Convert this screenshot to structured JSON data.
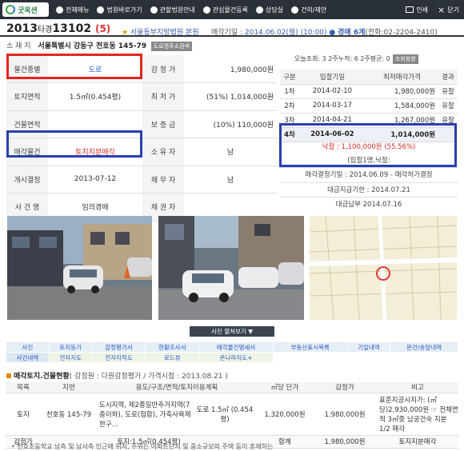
{
  "topbar": {
    "logo": "굿옥션",
    "menu": [
      "전체메뉴",
      "법원바로가기",
      "관할법원안내",
      "관심물건등록",
      "상담실",
      "건의/제안"
    ],
    "right": [
      "인쇄",
      "닫기"
    ]
  },
  "case": {
    "year": "2013",
    "type": "타경",
    "number": "13102",
    "count": "(5)",
    "court": "서울동부지방법원 본원",
    "sale_label": "매각기일 : ",
    "sale_date": "2014.06.02(월) (10:00)",
    "sale_dept": "경매 6계",
    "sale_phone": "(전화:02-2204-2410)"
  },
  "address": {
    "label": "소 재 지",
    "value": "서울특별시 강동구 천호동 145-79",
    "badge": "도로명주소검색"
  },
  "views": {
    "text": "오늘조회: 3 2주누적: 6 2주평균: 0",
    "button": "조회동향"
  },
  "info_rows": [
    {
      "h1": "물건종별",
      "v1": "도로",
      "h2": "감 정 가",
      "v2": "1,980,000원"
    },
    {
      "h1": "토지면적",
      "v1": "1.5㎡(0.454평)",
      "h2": "최 저 가",
      "v2": "(51%) 1,014,000원"
    },
    {
      "h1": "건물면적",
      "v1": "",
      "h2": "보 증 금",
      "v2": "(10%) 110,000원"
    },
    {
      "h1": "매각물건",
      "v1": "토지지분매각",
      "h2": "소 유 자",
      "v2": "남"
    },
    {
      "h1": "개시결정",
      "v1": "2013-07-12",
      "h2": "채 무 자",
      "v2": "남"
    },
    {
      "h1": "사 건 명",
      "v1": "임의경매",
      "h2": "채 권 자",
      "v2": ""
    }
  ],
  "bids": {
    "headers": [
      "구분",
      "입찰기일",
      "최저매각가격",
      "결과"
    ],
    "rows": [
      {
        "round": "1차",
        "date": "2014-02-10",
        "price": "1,980,000원",
        "result": "유찰"
      },
      {
        "round": "2차",
        "date": "2014-03-17",
        "price": "1,584,000원",
        "result": "유찰"
      },
      {
        "round": "3차",
        "date": "2014-04-21",
        "price": "1,267,000원",
        "result": "유찰"
      },
      {
        "round": "4차",
        "date": "2014-06-02",
        "price": "1,014,000원",
        "result": ""
      }
    ],
    "sold": "낙찰 : 1,100,000원 (55.56%)",
    "bidders": "(입찰1명,낙찰:",
    "post": [
      "매각결정기일 : 2014.06.09 - 매각허가결정",
      "대금지급기한 : 2014.07.21",
      "대금납부 2014.07.16"
    ]
  },
  "photo_button": "사진 펼쳐보기",
  "tabs_row1": [
    "사진",
    "토지등기",
    "감정평가서",
    "현황조사서",
    "매각물건명세서",
    "부동산표시목록",
    "기일내역",
    "문건/송달내역"
  ],
  "tabs_row2": [
    "사건내역",
    "전자지도",
    "전자지적도",
    "로드뷰",
    "온나라지도+"
  ],
  "land_section": {
    "title": "매각토지.건물현황",
    "sub": "( 감정원 : 다원감정평가 / 가격시점 : 2013.08.21 )"
  },
  "land_table": {
    "headers": [
      "목록",
      "지번",
      "용도/구조/면적/토지이용계획",
      "㎡당 단가",
      "감정가",
      "비고"
    ],
    "row": {
      "cat": "토지",
      "lot": "천호동 145-79",
      "use": "도시지역, 제2종일반주거지역(7층이하), 도로(접합), 가축사육제한구...",
      "area": "도로 1.5㎡ (0.454평)",
      "unit": "1,320,000원",
      "price": "1,980,000원",
      "note": "표준지공시지가: (㎡당)2,930,000원 ☞ 전체면적 3㎡중 남궁건숙 지분 1/2 매각"
    },
    "footer": {
      "label": "감정가",
      "area": "토지:1.5㎡(0.454평)",
      "sum_label": "합계",
      "sum": "1,980,000원",
      "type": "토지지분매각"
    }
  },
  "note": "• 천호초등학교 남측 및 남서측 인근에 위치, 주위는 아파트단지 및 중소규모의 주택 등이 혼재하는"
}
